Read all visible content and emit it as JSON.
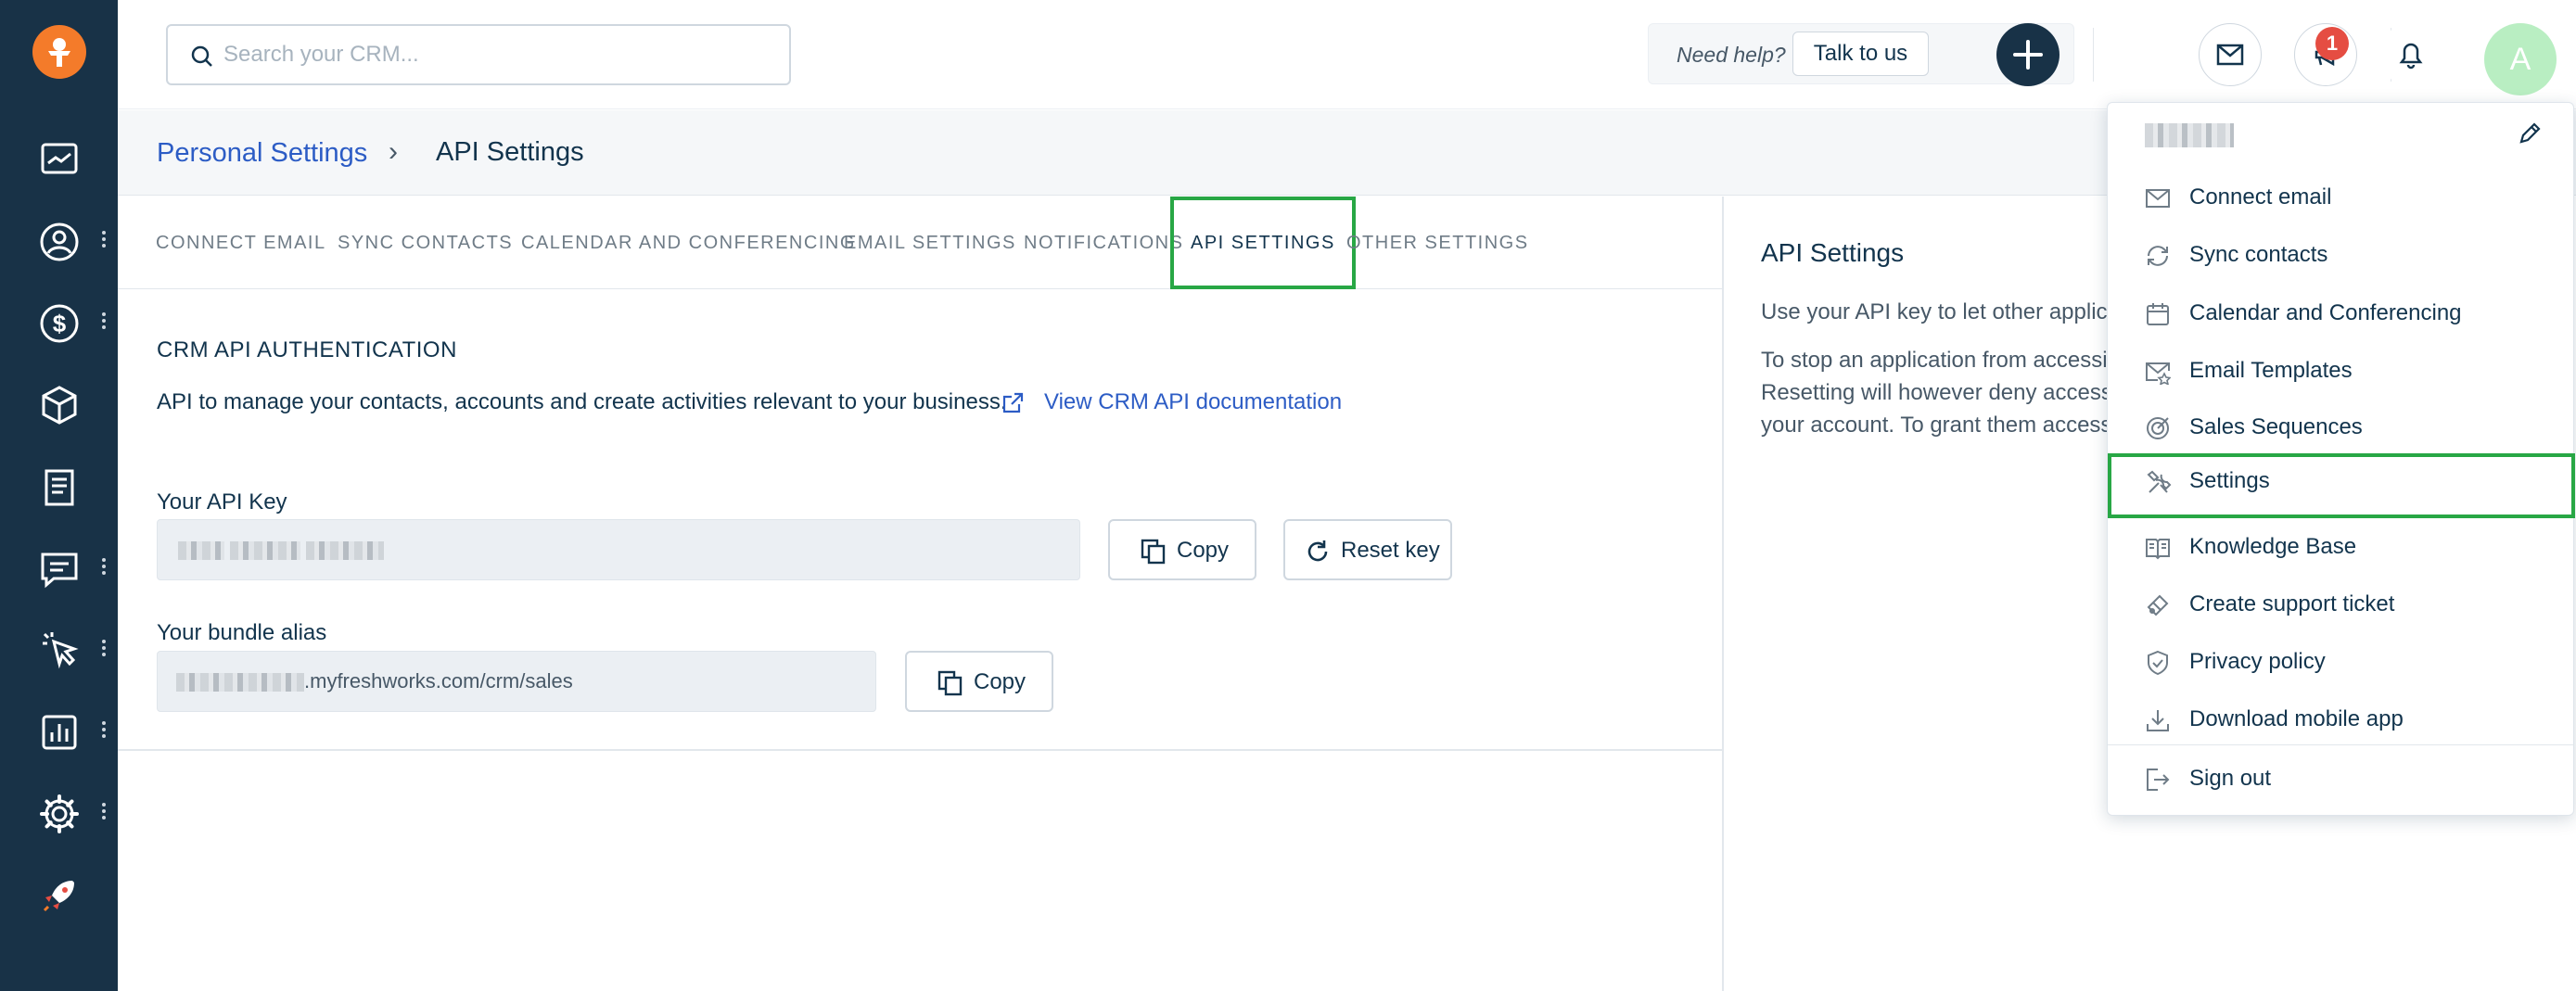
{
  "app": {
    "name": "Freshsales CRM"
  },
  "search": {
    "placeholder": "Search your CRM..."
  },
  "header": {
    "help_text": "Need help?",
    "talk_label": "Talk to us",
    "notification_count": "1",
    "avatar_letter": "A"
  },
  "breadcrumb": {
    "parent": "Personal Settings",
    "separator": "›",
    "current": "API Settings"
  },
  "tabs": [
    {
      "label": "CONNECT EMAIL"
    },
    {
      "label": "SYNC CONTACTS"
    },
    {
      "label": "CALENDAR AND CONFERENCING"
    },
    {
      "label": "EMAIL SETTINGS"
    },
    {
      "label": "NOTIFICATIONS"
    },
    {
      "label": "API SETTINGS",
      "active": true
    },
    {
      "label": "OTHER SETTINGS"
    }
  ],
  "main": {
    "section_title": "CRM API AUTHENTICATION",
    "description": "API to manage your contacts, accounts and create activities relevant to your business.",
    "doc_link": "View CRM API documentation",
    "api_key_label": "Your API Key",
    "bundle_label": "Your bundle alias",
    "bundle_value_suffix": ".myfreshworks.com/crm/sales",
    "copy_label": "Copy",
    "reset_label": "Reset key"
  },
  "right_pane": {
    "title": "API Settings",
    "line1": "Use your API key to let other applic",
    "line2": "To stop an application from accessi",
    "line3": "Resetting will however deny access",
    "line4": "your account. To grant them access"
  },
  "dropdown": {
    "items": [
      {
        "label": "Connect email",
        "icon": "mail-icon"
      },
      {
        "label": "Sync contacts",
        "icon": "sync-icon"
      },
      {
        "label": "Calendar and Conferencing",
        "icon": "calendar-icon"
      },
      {
        "label": "Email Templates",
        "icon": "email-template-icon"
      },
      {
        "label": "Sales Sequences",
        "icon": "target-icon"
      },
      {
        "label": "Settings",
        "icon": "tools-icon",
        "highlighted": true
      },
      {
        "label": "Knowledge Base",
        "icon": "book-icon"
      },
      {
        "label": "Create support ticket",
        "icon": "ticket-icon"
      },
      {
        "label": "Privacy policy",
        "icon": "shield-icon"
      },
      {
        "label": "Download mobile app",
        "icon": "download-icon"
      },
      {
        "label": "Sign out",
        "icon": "sign-out-icon"
      }
    ]
  },
  "colors": {
    "sidebar": "#183247",
    "accent": "#2c5cc5",
    "highlight": "#28a745",
    "logo": "#f47b2a",
    "badge": "#e54d42",
    "avatar": "#b9eec2"
  }
}
